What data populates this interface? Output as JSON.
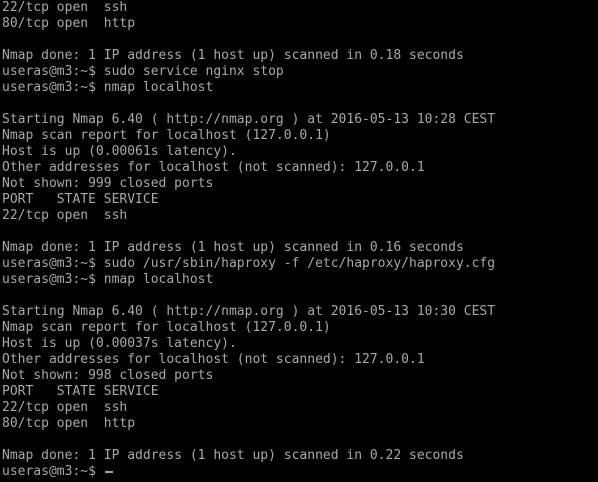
{
  "terminal": {
    "lines": [
      "22/tcp open  ssh",
      "80/tcp open  http",
      "",
      "Nmap done: 1 IP address (1 host up) scanned in 0.18 seconds",
      "useras@m3:~$ sudo service nginx stop",
      "useras@m3:~$ nmap localhost",
      "",
      "Starting Nmap 6.40 ( http://nmap.org ) at 2016-05-13 10:28 CEST",
      "Nmap scan report for localhost (127.0.0.1)",
      "Host is up (0.00061s latency).",
      "Other addresses for localhost (not scanned): 127.0.0.1",
      "Not shown: 999 closed ports",
      "PORT   STATE SERVICE",
      "22/tcp open  ssh",
      "",
      "Nmap done: 1 IP address (1 host up) scanned in 0.16 seconds",
      "useras@m3:~$ sudo /usr/sbin/haproxy -f /etc/haproxy/haproxy.cfg",
      "useras@m3:~$ nmap localhost",
      "",
      "Starting Nmap 6.40 ( http://nmap.org ) at 2016-05-13 10:30 CEST",
      "Nmap scan report for localhost (127.0.0.1)",
      "Host is up (0.00037s latency).",
      "Other addresses for localhost (not scanned): 127.0.0.1",
      "Not shown: 998 closed ports",
      "PORT   STATE SERVICE",
      "22/tcp open  ssh",
      "80/tcp open  http",
      "",
      "Nmap done: 1 IP address (1 host up) scanned in 0.22 seconds"
    ],
    "current_prompt": "useras@m3:~$ ",
    "colors": {
      "background": "#000000",
      "text": "#a8a8a8"
    }
  }
}
